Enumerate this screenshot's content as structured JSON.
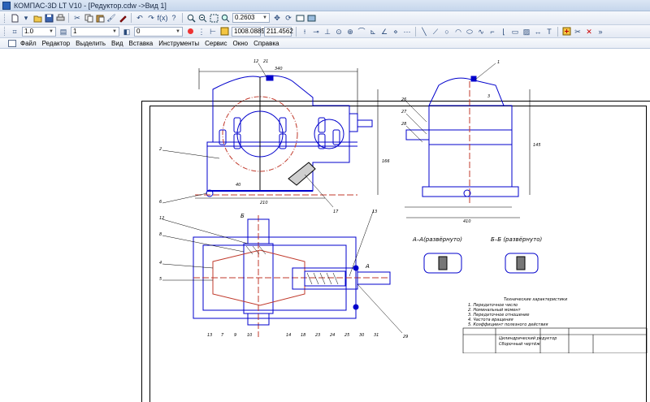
{
  "window": {
    "title": "КОМПАС-3D LT V10 - [Редуктор.cdw ->Вид 1]"
  },
  "toolbar1": {
    "zoom_value": "0.2603",
    "icons": [
      "new-icon",
      "open-icon",
      "save-icon",
      "print-icon",
      "cut-icon",
      "copy-icon",
      "paste-icon",
      "format-icon",
      "properties-icon",
      "undo-icon",
      "redo-icon",
      "function-icon",
      "help-icon",
      "zoom-in-icon",
      "zoom-out-icon",
      "zoom-window-icon",
      "zoom-fit-icon",
      "pan-icon",
      "refresh-icon",
      "show-all-icon",
      "view-manager-icon"
    ]
  },
  "toolbar2": {
    "step_value": "1.0",
    "style_value": "1",
    "layer_value": "0",
    "coord_x": "1008.0885",
    "coord_y": "211.4562"
  },
  "menu": {
    "items": [
      "Файл",
      "Редактор",
      "Выделить",
      "Вид",
      "Вставка",
      "Инструменты",
      "Сервис",
      "Окно",
      "Справка"
    ]
  },
  "drawing": {
    "section_a": "А–А(развёрнуто)",
    "section_b": "Б–Б (развёрнуто)",
    "tech_title": "Технические характеристики",
    "tech_lines": [
      "1. Передаточное число",
      "2. Номинальный момент",
      "3. Передаточное отношение",
      "4. Частота вращения",
      "5. Коэффициент полезного действия"
    ],
    "stamp_title": "Цилиндрический редуктор",
    "stamp_subtitle": "Сборочный чертёж",
    "view_label_a": "A",
    "view_label_b": "Б",
    "dimension_labels": [
      "340",
      "40",
      "210",
      "410",
      "166",
      "145"
    ],
    "callouts": [
      "1",
      "2",
      "3",
      "4",
      "5",
      "6",
      "7",
      "8",
      "9",
      "10",
      "11",
      "12",
      "13",
      "14",
      "15",
      "16",
      "17",
      "18",
      "19",
      "20",
      "21",
      "22",
      "23",
      "24",
      "25",
      "26",
      "27",
      "28",
      "29",
      "30",
      "31"
    ]
  },
  "colors": {
    "geometry": "#0000cc",
    "centerline": "#c0392b",
    "hatch": "#000000",
    "toolbar_bg": "#e8edf5",
    "titlebar_bg": "#cfdcef"
  }
}
